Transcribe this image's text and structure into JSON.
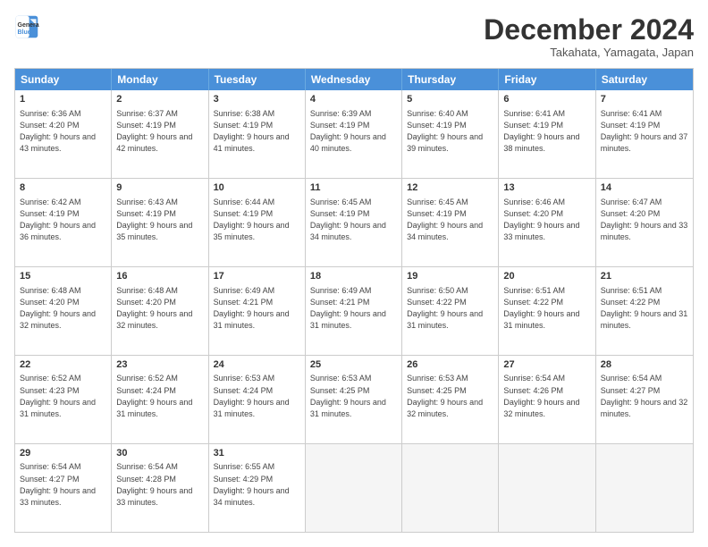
{
  "header": {
    "logo_line1": "General",
    "logo_line2": "Blue",
    "month_title": "December 2024",
    "location": "Takahata, Yamagata, Japan"
  },
  "calendar": {
    "days_of_week": [
      "Sunday",
      "Monday",
      "Tuesday",
      "Wednesday",
      "Thursday",
      "Friday",
      "Saturday"
    ],
    "weeks": [
      [
        {
          "day": "1",
          "sunrise": "6:36 AM",
          "sunset": "4:20 PM",
          "daylight": "9 hours and 43 minutes."
        },
        {
          "day": "2",
          "sunrise": "6:37 AM",
          "sunset": "4:19 PM",
          "daylight": "9 hours and 42 minutes."
        },
        {
          "day": "3",
          "sunrise": "6:38 AM",
          "sunset": "4:19 PM",
          "daylight": "9 hours and 41 minutes."
        },
        {
          "day": "4",
          "sunrise": "6:39 AM",
          "sunset": "4:19 PM",
          "daylight": "9 hours and 40 minutes."
        },
        {
          "day": "5",
          "sunrise": "6:40 AM",
          "sunset": "4:19 PM",
          "daylight": "9 hours and 39 minutes."
        },
        {
          "day": "6",
          "sunrise": "6:41 AM",
          "sunset": "4:19 PM",
          "daylight": "9 hours and 38 minutes."
        },
        {
          "day": "7",
          "sunrise": "6:41 AM",
          "sunset": "4:19 PM",
          "daylight": "9 hours and 37 minutes."
        }
      ],
      [
        {
          "day": "8",
          "sunrise": "6:42 AM",
          "sunset": "4:19 PM",
          "daylight": "9 hours and 36 minutes."
        },
        {
          "day": "9",
          "sunrise": "6:43 AM",
          "sunset": "4:19 PM",
          "daylight": "9 hours and 35 minutes."
        },
        {
          "day": "10",
          "sunrise": "6:44 AM",
          "sunset": "4:19 PM",
          "daylight": "9 hours and 35 minutes."
        },
        {
          "day": "11",
          "sunrise": "6:45 AM",
          "sunset": "4:19 PM",
          "daylight": "9 hours and 34 minutes."
        },
        {
          "day": "12",
          "sunrise": "6:45 AM",
          "sunset": "4:19 PM",
          "daylight": "9 hours and 34 minutes."
        },
        {
          "day": "13",
          "sunrise": "6:46 AM",
          "sunset": "4:20 PM",
          "daylight": "9 hours and 33 minutes."
        },
        {
          "day": "14",
          "sunrise": "6:47 AM",
          "sunset": "4:20 PM",
          "daylight": "9 hours and 33 minutes."
        }
      ],
      [
        {
          "day": "15",
          "sunrise": "6:48 AM",
          "sunset": "4:20 PM",
          "daylight": "9 hours and 32 minutes."
        },
        {
          "day": "16",
          "sunrise": "6:48 AM",
          "sunset": "4:20 PM",
          "daylight": "9 hours and 32 minutes."
        },
        {
          "day": "17",
          "sunrise": "6:49 AM",
          "sunset": "4:21 PM",
          "daylight": "9 hours and 31 minutes."
        },
        {
          "day": "18",
          "sunrise": "6:49 AM",
          "sunset": "4:21 PM",
          "daylight": "9 hours and 31 minutes."
        },
        {
          "day": "19",
          "sunrise": "6:50 AM",
          "sunset": "4:22 PM",
          "daylight": "9 hours and 31 minutes."
        },
        {
          "day": "20",
          "sunrise": "6:51 AM",
          "sunset": "4:22 PM",
          "daylight": "9 hours and 31 minutes."
        },
        {
          "day": "21",
          "sunrise": "6:51 AM",
          "sunset": "4:22 PM",
          "daylight": "9 hours and 31 minutes."
        }
      ],
      [
        {
          "day": "22",
          "sunrise": "6:52 AM",
          "sunset": "4:23 PM",
          "daylight": "9 hours and 31 minutes."
        },
        {
          "day": "23",
          "sunrise": "6:52 AM",
          "sunset": "4:24 PM",
          "daylight": "9 hours and 31 minutes."
        },
        {
          "day": "24",
          "sunrise": "6:53 AM",
          "sunset": "4:24 PM",
          "daylight": "9 hours and 31 minutes."
        },
        {
          "day": "25",
          "sunrise": "6:53 AM",
          "sunset": "4:25 PM",
          "daylight": "9 hours and 31 minutes."
        },
        {
          "day": "26",
          "sunrise": "6:53 AM",
          "sunset": "4:25 PM",
          "daylight": "9 hours and 32 minutes."
        },
        {
          "day": "27",
          "sunrise": "6:54 AM",
          "sunset": "4:26 PM",
          "daylight": "9 hours and 32 minutes."
        },
        {
          "day": "28",
          "sunrise": "6:54 AM",
          "sunset": "4:27 PM",
          "daylight": "9 hours and 32 minutes."
        }
      ],
      [
        {
          "day": "29",
          "sunrise": "6:54 AM",
          "sunset": "4:27 PM",
          "daylight": "9 hours and 33 minutes."
        },
        {
          "day": "30",
          "sunrise": "6:54 AM",
          "sunset": "4:28 PM",
          "daylight": "9 hours and 33 minutes."
        },
        {
          "day": "31",
          "sunrise": "6:55 AM",
          "sunset": "4:29 PM",
          "daylight": "9 hours and 34 minutes."
        },
        {
          "day": "",
          "sunrise": "",
          "sunset": "",
          "daylight": ""
        },
        {
          "day": "",
          "sunrise": "",
          "sunset": "",
          "daylight": ""
        },
        {
          "day": "",
          "sunrise": "",
          "sunset": "",
          "daylight": ""
        },
        {
          "day": "",
          "sunrise": "",
          "sunset": "",
          "daylight": ""
        }
      ]
    ]
  }
}
